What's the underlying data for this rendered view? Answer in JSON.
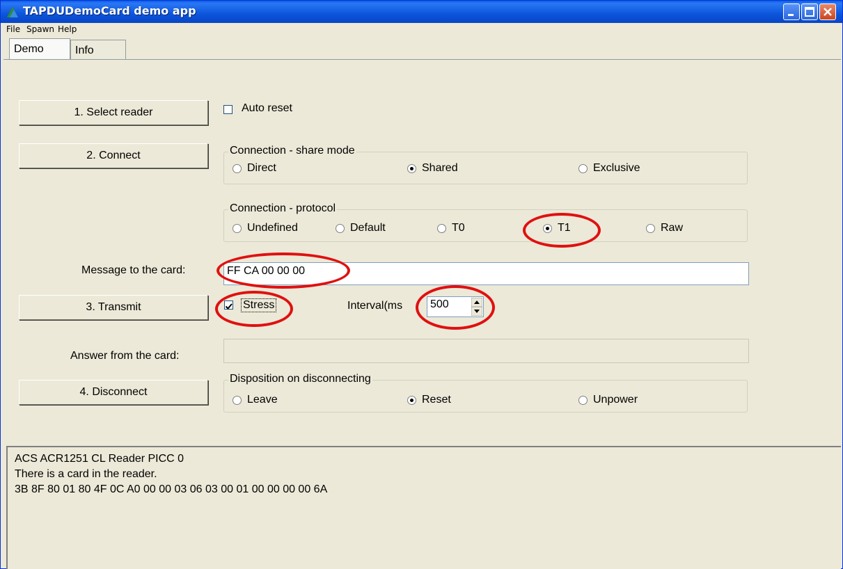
{
  "window": {
    "title": "TAPDUDemoCard demo app"
  },
  "menu": [
    "File",
    "Spawn",
    "Help"
  ],
  "tabs": [
    "Demo",
    "Info"
  ],
  "buttons": {
    "select_reader": "1. Select reader",
    "connect": "2. Connect",
    "transmit": "3. Transmit",
    "disconnect": "4. Disconnect"
  },
  "auto_reset": {
    "label": "Auto reset",
    "checked": false
  },
  "share_mode": {
    "title": "Connection - share mode",
    "options": [
      "Direct",
      "Shared",
      "Exclusive"
    ],
    "selected": "Shared"
  },
  "protocol": {
    "title": "Connection - protocol",
    "options": [
      "Undefined",
      "Default",
      "T0",
      "T1",
      "Raw"
    ],
    "selected": "T1"
  },
  "message": {
    "label": "Message to the card:",
    "value": "FF CA 00 00 00"
  },
  "stress": {
    "label": "Stress",
    "checked": true
  },
  "interval": {
    "label": "Interval(ms",
    "value": "500"
  },
  "answer": {
    "label": "Answer from the card:",
    "value": ""
  },
  "disposition": {
    "title": "Disposition on disconnecting",
    "options": [
      "Leave",
      "Reset",
      "Unpower"
    ],
    "selected": "Reset"
  },
  "log": [
    "ACS ACR1251 CL Reader PICC 0",
    "There is a card in the reader.",
    "3B 8F 80 01 80 4F 0C A0 00 00 03 06 03 00 01 00 00 00 00 6A"
  ],
  "colors": {
    "annotation": "#e01010",
    "titlebar": "#0c55db",
    "face": "#ece9d8"
  }
}
